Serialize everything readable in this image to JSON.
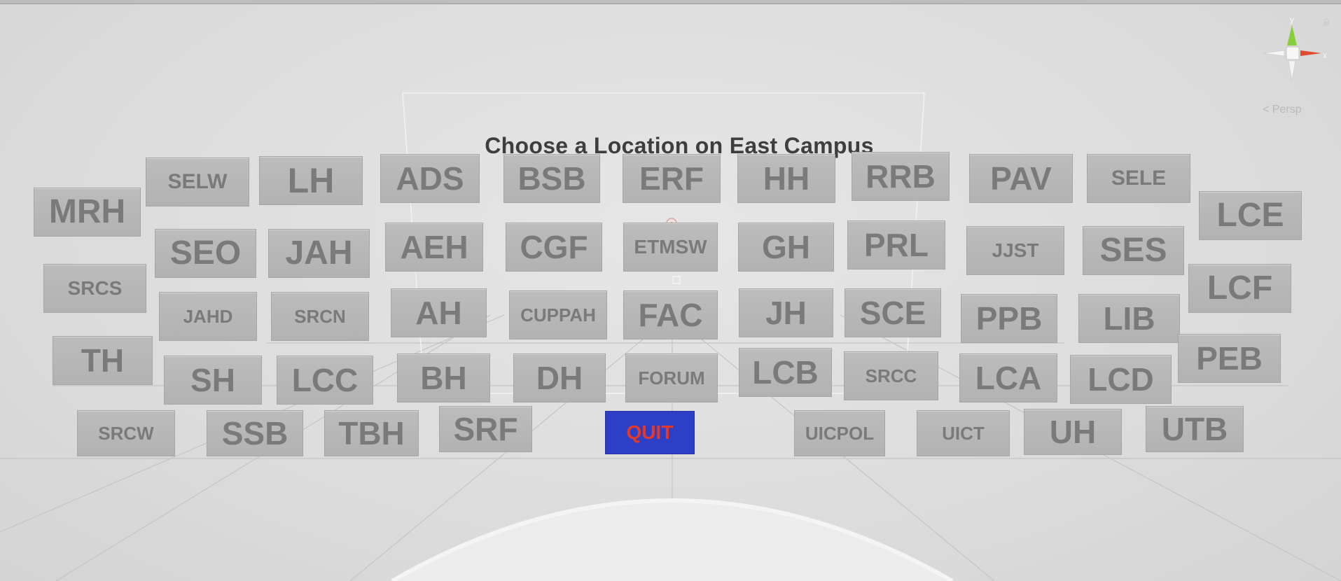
{
  "scene": {
    "title": "Choose a Location on East Campus",
    "persp_label": "Persp",
    "gizmo": {
      "y": "y",
      "x": "x"
    },
    "quit_label": "QUIT",
    "colors": {
      "quit_bg": "#2d3fc6",
      "quit_text": "#e23a2a",
      "tile_bg": "#b8b8b8",
      "tile_text": "#7a7a7a"
    }
  },
  "locations": [
    "SELW",
    "LH",
    "ADS",
    "BSB",
    "ERF",
    "HH",
    "RRB",
    "PAV",
    "SELE",
    "MRH",
    "LCE",
    "SEO",
    "JAH",
    "AEH",
    "CGF",
    "ETMSW",
    "GH",
    "PRL",
    "JJST",
    "SES",
    "SRCS",
    "LCF",
    "JAHD",
    "SRCN",
    "AH",
    "CUPPAH",
    "FAC",
    "JH",
    "SCE",
    "PPB",
    "LIB",
    "TH",
    "PEB",
    "SH",
    "LCC",
    "BH",
    "DH",
    "FORUM",
    "LCB",
    "SRCC",
    "LCA",
    "LCD",
    "SRCW",
    "SSB",
    "TBH",
    "SRF",
    "UICPOL",
    "UICT",
    "UH",
    "UTB"
  ]
}
